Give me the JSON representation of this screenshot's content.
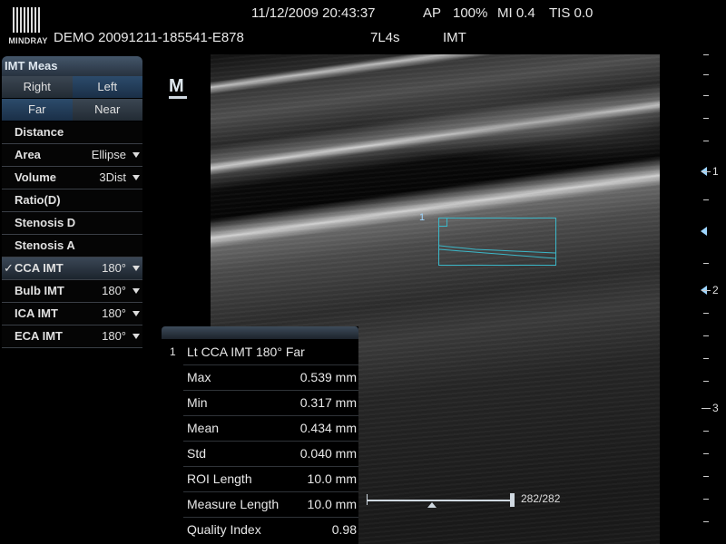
{
  "header": {
    "brand": "MINDRAY",
    "patient_id": "DEMO 20091211-185541-E878",
    "datetime": "11/12/2009 20:43:37",
    "ap": "AP",
    "power": "100%",
    "mi": "MI 0.4",
    "tis": "TIS 0.0",
    "probe": "7L4s",
    "exam": "IMT"
  },
  "menu": {
    "title": "IMT Meas",
    "side": {
      "right": "Right",
      "left": "Left",
      "selected": "Left"
    },
    "wall": {
      "far": "Far",
      "near": "Near",
      "selected": "Far"
    },
    "items": [
      {
        "label": "Distance",
        "value": ""
      },
      {
        "label": "Area",
        "value": "Ellipse"
      },
      {
        "label": "Volume",
        "value": "3Dist"
      },
      {
        "label": "Ratio(D)",
        "value": ""
      },
      {
        "label": "Stenosis D",
        "value": ""
      },
      {
        "label": "Stenosis A",
        "value": ""
      },
      {
        "label": "CCA IMT",
        "value": "180°",
        "checked": "✓"
      },
      {
        "label": "Bulb IMT",
        "value": "180°"
      },
      {
        "label": "ICA IMT",
        "value": "180°"
      },
      {
        "label": "ECA IMT",
        "value": "180°"
      }
    ]
  },
  "image": {
    "mode_icon": "M",
    "roi_label": "1",
    "focus_marks": [
      "1",
      "2"
    ],
    "depth_label": "3"
  },
  "results": {
    "index": "1",
    "title": "Lt CCA IMT 180° Far",
    "rows": [
      {
        "key": "Max",
        "value": "0.539 mm"
      },
      {
        "key": "Min",
        "value": "0.317 mm"
      },
      {
        "key": "Mean",
        "value": "0.434 mm"
      },
      {
        "key": "Std",
        "value": "0.040 mm"
      },
      {
        "key": "ROI Length",
        "value": "10.0 mm"
      },
      {
        "key": "Measure Length",
        "value": "10.0 mm"
      },
      {
        "key": "Quality Index",
        "value": "0.98"
      }
    ]
  },
  "cine": {
    "frame": "282/282"
  },
  "colors": {
    "accent": "#3bb7c8",
    "selected": "#2c4b6b"
  }
}
